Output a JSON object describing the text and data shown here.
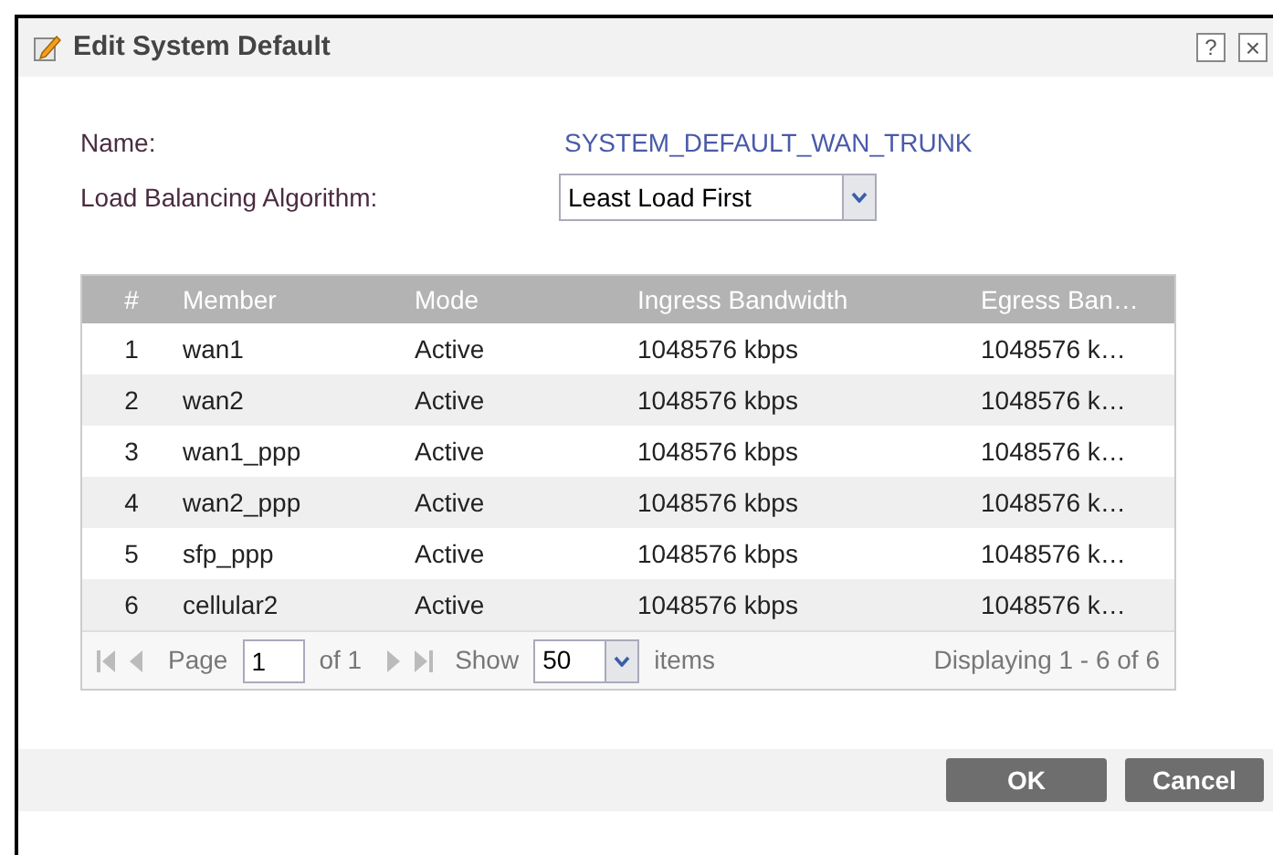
{
  "dialog": {
    "title": "Edit System Default",
    "help": "?",
    "close": "×"
  },
  "form": {
    "name_label": "Name:",
    "name_value": "SYSTEM_DEFAULT_WAN_TRUNK",
    "algorithm_label": "Load Balancing Algorithm:",
    "algorithm_value": "Least Load First"
  },
  "table": {
    "columns": [
      "#",
      "Member",
      "Mode",
      "Ingress Bandwidth",
      "Egress Ban…"
    ],
    "rows": [
      [
        "1",
        "wan1",
        "Active",
        "1048576 kbps",
        "1048576 k…"
      ],
      [
        "2",
        "wan2",
        "Active",
        "1048576 kbps",
        "1048576 k…"
      ],
      [
        "3",
        "wan1_ppp",
        "Active",
        "1048576 kbps",
        "1048576 k…"
      ],
      [
        "4",
        "wan2_ppp",
        "Active",
        "1048576 kbps",
        "1048576 k…"
      ],
      [
        "5",
        "sfp_ppp",
        "Active",
        "1048576 kbps",
        "1048576 k…"
      ],
      [
        "6",
        "cellular2",
        "Active",
        "1048576 kbps",
        "1048576 k…"
      ]
    ]
  },
  "pager": {
    "page_label": "Page",
    "page_value": "1",
    "of": "of 1",
    "show_label": "Show",
    "show_value": "50",
    "items_label": "items",
    "display": "Displaying 1 - 6 of 6"
  },
  "buttons": [
    "OK",
    "Cancel"
  ]
}
